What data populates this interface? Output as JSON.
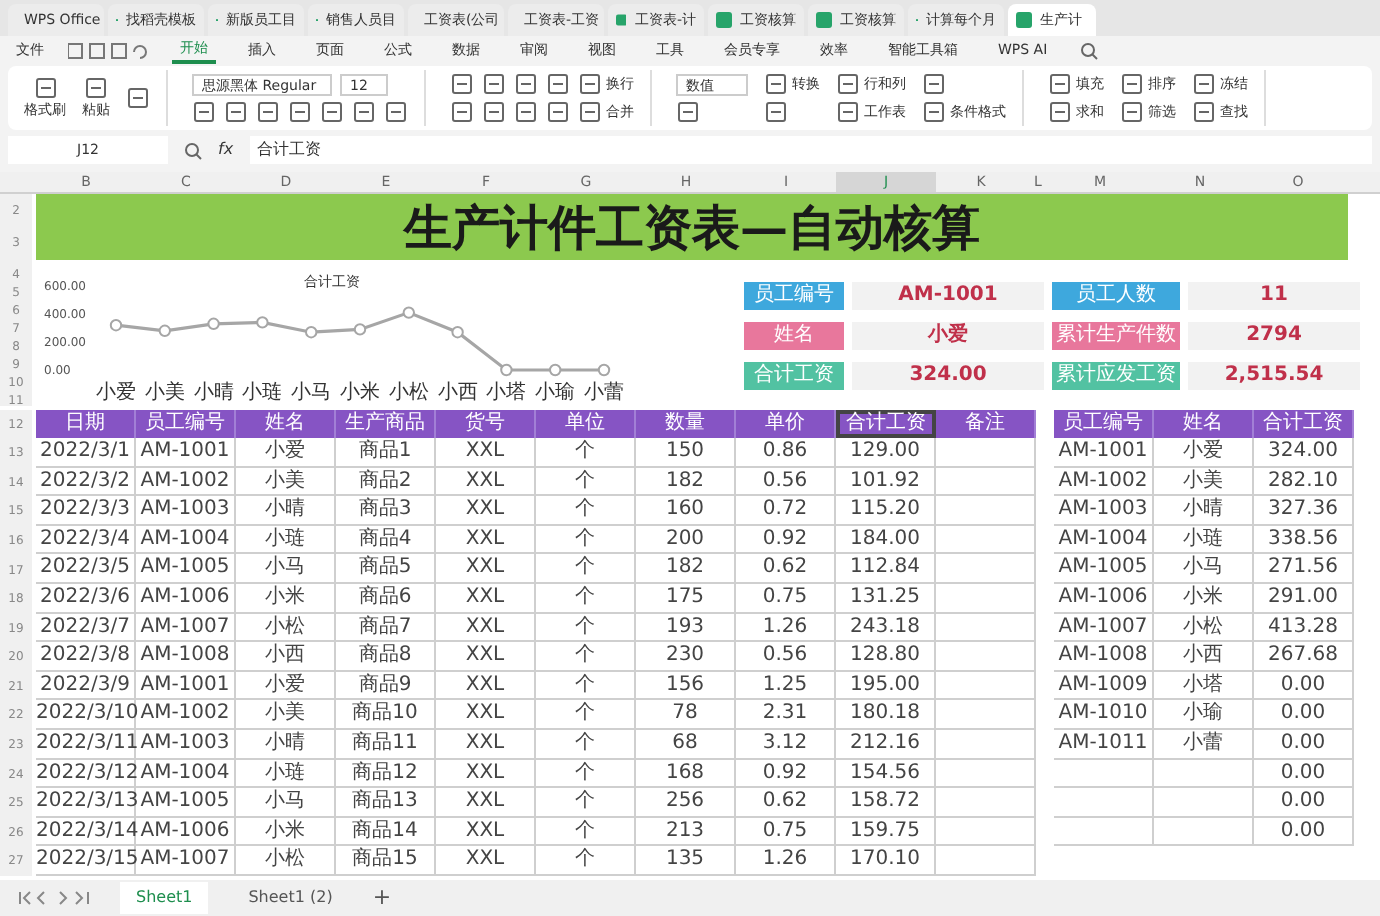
{
  "browser_tabs": [
    {
      "label": "WPS Office",
      "selected": false
    },
    {
      "label": "找稻壳模板",
      "selected": false
    },
    {
      "label": "新版员工目",
      "selected": false
    },
    {
      "label": "销售人员目",
      "selected": false
    },
    {
      "label": "工资表(公司",
      "selected": false
    },
    {
      "label": "工资表-工资",
      "selected": false
    },
    {
      "label": "工资表-计",
      "selected": false
    },
    {
      "label": "工资核算",
      "selected": false
    },
    {
      "label": "工资核算",
      "selected": false
    },
    {
      "label": "计算每个月",
      "selected": false
    },
    {
      "label": "生产计",
      "selected": true
    }
  ],
  "menu": {
    "file": "文件",
    "tabs": [
      {
        "label": "开始",
        "selected": true
      },
      {
        "label": "插入",
        "selected": false
      },
      {
        "label": "页面",
        "selected": false
      },
      {
        "label": "公式",
        "selected": false
      },
      {
        "label": "数据",
        "selected": false
      },
      {
        "label": "审阅",
        "selected": false
      },
      {
        "label": "视图",
        "selected": false
      },
      {
        "label": "工具",
        "selected": false
      },
      {
        "label": "会员专享",
        "selected": false
      },
      {
        "label": "效率",
        "selected": false
      },
      {
        "label": "智能工具箱",
        "selected": false
      },
      {
        "label": "WPS AI",
        "selected": false
      }
    ]
  },
  "ribbon": [
    {
      "kind": "big",
      "labels": [
        "格式刷",
        "粘贴"
      ]
    },
    {
      "kind": "font",
      "font": "思源黑体 Regular",
      "size": "12"
    },
    {
      "kind": "align",
      "labels": [
        "换行",
        "合并"
      ]
    },
    {
      "kind": "number",
      "format": "数值",
      "labels": [
        "转换",
        "行和列",
        "工作表",
        "条件格式"
      ]
    },
    {
      "kind": "edit",
      "labels": [
        "填充",
        "排序",
        "冻结",
        "求和",
        "筛选",
        "查找"
      ]
    }
  ],
  "formula_bar": {
    "cell": "J12",
    "fx": "fx",
    "value": "合计工资"
  },
  "column_letters": [
    {
      "label": "B",
      "selected": false
    },
    {
      "label": "C",
      "selected": false
    },
    {
      "label": "D",
      "selected": false
    },
    {
      "label": "E",
      "selected": false
    },
    {
      "label": "F",
      "selected": false
    },
    {
      "label": "G",
      "selected": false
    },
    {
      "label": "H",
      "selected": false
    },
    {
      "label": "I",
      "selected": false
    },
    {
      "label": "J",
      "selected": true
    },
    {
      "label": "K",
      "selected": false
    },
    {
      "label": "L",
      "selected": false
    },
    {
      "label": "M",
      "selected": false
    },
    {
      "label": "N",
      "selected": false
    },
    {
      "label": "O",
      "selected": false
    }
  ],
  "row_numbers": [
    "2",
    "3",
    "4",
    "5",
    "6",
    "7",
    "8",
    "9",
    "10",
    "11",
    "12",
    "13",
    "14",
    "15",
    "16",
    "17",
    "18",
    "19",
    "20",
    "21",
    "22",
    "23",
    "24",
    "25",
    "26",
    "27"
  ],
  "title": "生产计件工资表—自动核算",
  "chart": {
    "chart_data": {
      "type": "line",
      "categories": [
        "小爱",
        "小美",
        "小晴",
        "小琏",
        "小马",
        "小米",
        "小松",
        "小西",
        "小塔",
        "小瑜",
        "小蕾"
      ],
      "series": [
        {
          "name": "合计工资",
          "color": "#a6a6a6",
          "marker": "circle",
          "values": [
            320,
            280,
            330,
            340,
            270,
            290,
            410,
            270,
            0,
            0,
            0
          ]
        }
      ],
      "ylim": [
        0,
        600
      ],
      "yticks": [
        {
          "value": 0,
          "label": "0.00"
        },
        {
          "value": 200,
          "label": "200.00"
        },
        {
          "value": 400,
          "label": "400.00"
        },
        {
          "value": 600,
          "label": "600.00"
        }
      ]
    }
  },
  "cards": [
    {
      "label": "员工编号",
      "value": "AM-1001",
      "color": "#3ea8dd"
    },
    {
      "label": "员工人数",
      "value": "11",
      "color": "#3ea8dd"
    },
    {
      "label": "姓名",
      "value": "小爱",
      "color": "#e8779c"
    },
    {
      "label": "累计生产件数",
      "value": "2794",
      "color": "#e8779c"
    },
    {
      "label": "合计工资",
      "value": "324.00",
      "color": "#52c2a2"
    },
    {
      "label": "累计应发工资",
      "value": "2,515.54",
      "color": "#52c2a2"
    }
  ],
  "table": {
    "columns": [
      {
        "label": "日期",
        "selected": false
      },
      {
        "label": "员工编号",
        "selected": false
      },
      {
        "label": "姓名",
        "selected": false
      },
      {
        "label": "生产商品",
        "selected": false
      },
      {
        "label": "货号",
        "selected": false
      },
      {
        "label": "单位",
        "selected": false
      },
      {
        "label": "数量",
        "selected": false
      },
      {
        "label": "单价",
        "selected": false
      },
      {
        "label": "合计工资",
        "selected": true
      },
      {
        "label": "备注",
        "selected": false
      }
    ],
    "rows": [
      [
        "2022/3/1",
        "AM-1001",
        "小爱",
        "商品1",
        "XXL",
        "个",
        "150",
        "0.86",
        "129.00",
        ""
      ],
      [
        "2022/3/2",
        "AM-1002",
        "小美",
        "商品2",
        "XXL",
        "个",
        "182",
        "0.56",
        "101.92",
        ""
      ],
      [
        "2022/3/3",
        "AM-1003",
        "小晴",
        "商品3",
        "XXL",
        "个",
        "160",
        "0.72",
        "115.20",
        ""
      ],
      [
        "2022/3/4",
        "AM-1004",
        "小琏",
        "商品4",
        "XXL",
        "个",
        "200",
        "0.92",
        "184.00",
        ""
      ],
      [
        "2022/3/5",
        "AM-1005",
        "小马",
        "商品5",
        "XXL",
        "个",
        "182",
        "0.62",
        "112.84",
        ""
      ],
      [
        "2022/3/6",
        "AM-1006",
        "小米",
        "商品6",
        "XXL",
        "个",
        "175",
        "0.75",
        "131.25",
        ""
      ],
      [
        "2022/3/7",
        "AM-1007",
        "小松",
        "商品7",
        "XXL",
        "个",
        "193",
        "1.26",
        "243.18",
        ""
      ],
      [
        "2022/3/8",
        "AM-1008",
        "小西",
        "商品8",
        "XXL",
        "个",
        "230",
        "0.56",
        "128.80",
        ""
      ],
      [
        "2022/3/9",
        "AM-1001",
        "小爱",
        "商品9",
        "XXL",
        "个",
        "156",
        "1.25",
        "195.00",
        ""
      ],
      [
        "2022/3/10",
        "AM-1002",
        "小美",
        "商品10",
        "XXL",
        "个",
        "78",
        "2.31",
        "180.18",
        ""
      ],
      [
        "2022/3/11",
        "AM-1003",
        "小晴",
        "商品11",
        "XXL",
        "个",
        "68",
        "3.12",
        "212.16",
        ""
      ],
      [
        "2022/3/12",
        "AM-1004",
        "小琏",
        "商品12",
        "XXL",
        "个",
        "168",
        "0.92",
        "154.56",
        ""
      ],
      [
        "2022/3/13",
        "AM-1005",
        "小马",
        "商品13",
        "XXL",
        "个",
        "256",
        "0.62",
        "158.72",
        ""
      ],
      [
        "2022/3/14",
        "AM-1006",
        "小米",
        "商品14",
        "XXL",
        "个",
        "213",
        "0.75",
        "159.75",
        ""
      ],
      [
        "2022/3/15",
        "AM-1007",
        "小松",
        "商品15",
        "XXL",
        "个",
        "135",
        "1.26",
        "170.10",
        ""
      ]
    ]
  },
  "summary_table": {
    "columns": [
      "员工编号",
      "姓名",
      "合计工资"
    ],
    "rows": [
      [
        "AM-1001",
        "小爱",
        "324.00"
      ],
      [
        "AM-1002",
        "小美",
        "282.10"
      ],
      [
        "AM-1003",
        "小晴",
        "327.36"
      ],
      [
        "AM-1004",
        "小琏",
        "338.56"
      ],
      [
        "AM-1005",
        "小马",
        "271.56"
      ],
      [
        "AM-1006",
        "小米",
        "291.00"
      ],
      [
        "AM-1007",
        "小松",
        "413.28"
      ],
      [
        "AM-1008",
        "小西",
        "267.68"
      ],
      [
        "AM-1009",
        "小塔",
        "0.00"
      ],
      [
        "AM-1010",
        "小瑜",
        "0.00"
      ],
      [
        "AM-1011",
        "小蕾",
        "0.00"
      ],
      [
        "",
        "",
        "0.00"
      ],
      [
        "",
        "",
        "0.00"
      ],
      [
        "",
        "",
        "0.00"
      ]
    ]
  },
  "sheets": [
    {
      "label": "Sheet1",
      "selected": true
    },
    {
      "label": "Sheet1 (2)",
      "selected": false
    }
  ],
  "add_sheet": "+"
}
